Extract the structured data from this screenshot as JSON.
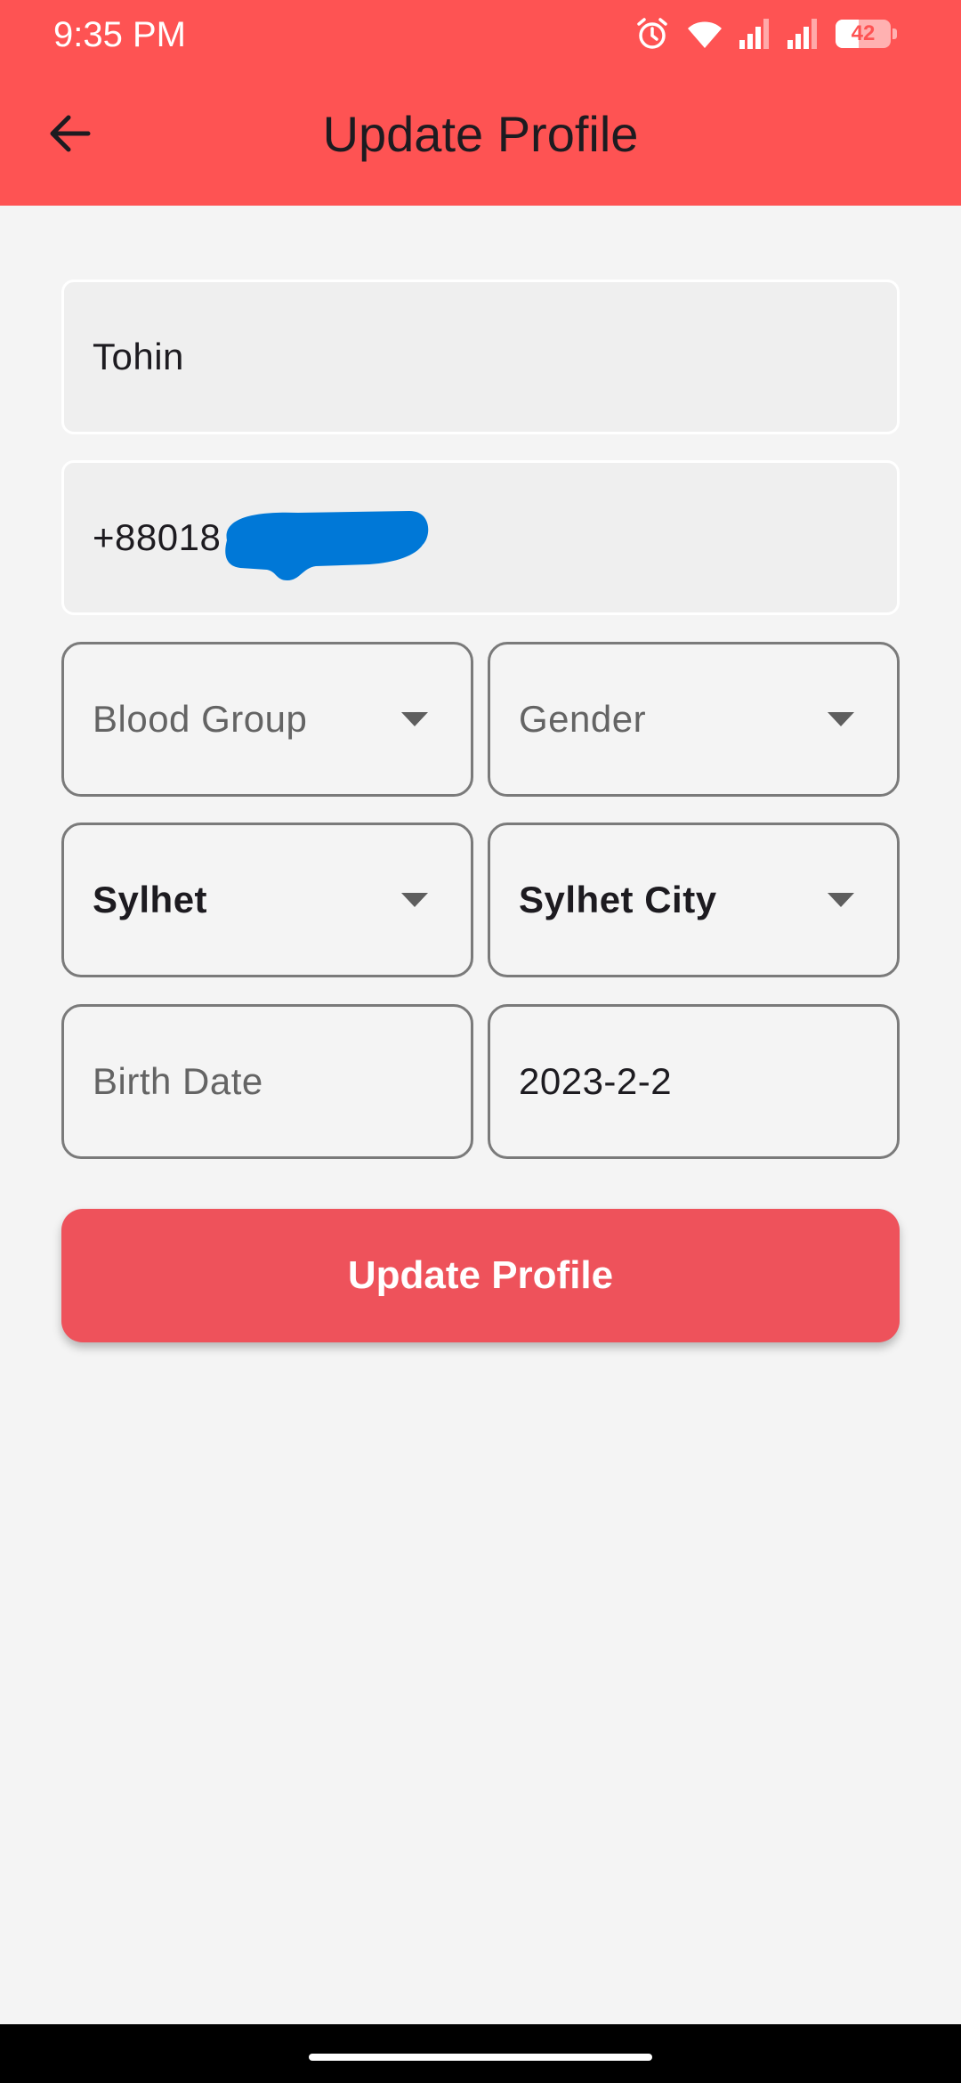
{
  "status_bar": {
    "time": "9:35 PM",
    "battery_level": "42",
    "battery_fraction": 0.42,
    "icons": [
      "alarm-icon",
      "wifi-icon",
      "signal-icon",
      "signal-icon",
      "battery-icon"
    ]
  },
  "app_bar": {
    "title": "Update Profile",
    "back_icon": "arrow-back-icon",
    "background_color": "#fe5353"
  },
  "form": {
    "name_value": "Tohin",
    "phone_value": "+88018",
    "blood_group_placeholder": "Blood Group",
    "gender_placeholder": "Gender",
    "division_value": "Sylhet",
    "city_value": "Sylhet City",
    "birth_date_placeholder": "Birth Date",
    "date_value": "2023-2-2"
  },
  "actions": {
    "update_label": "Update Profile",
    "button_color": "#ee525b"
  }
}
